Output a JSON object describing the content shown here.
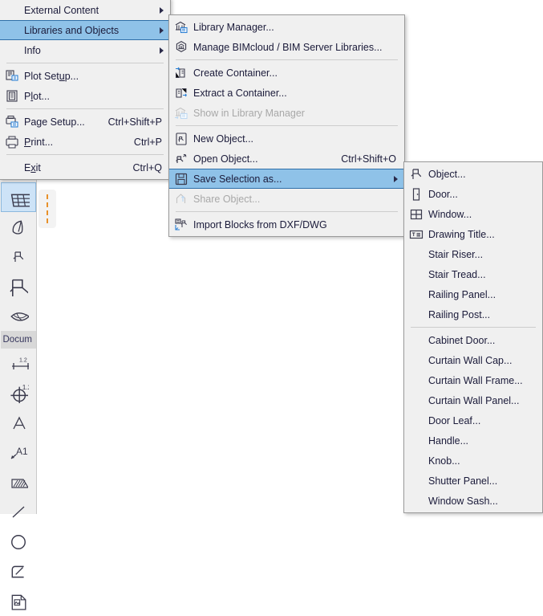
{
  "app": {
    "accent_highlight": "#8fc2e8",
    "highlight_border": "#2f6fa8",
    "panel_bg": "#f0f0f0",
    "panel_border": "#9a9a9a",
    "text_color": "#1b1b3a",
    "disabled_color": "#a8a8a8",
    "toolbar_bg": "#efefef",
    "toolbar_selected_bg": "#cde3f7",
    "canvas_bg": "#ffffff",
    "palette_dash_color": "#e8912a"
  },
  "toolbar": {
    "name": "toolbox-palette",
    "section_label": "Docum",
    "items": [
      {
        "name": "tool-shell",
        "icon": "shell-roof-icon",
        "selected": false
      },
      {
        "name": "tool-mesh",
        "icon": "mesh-grid-icon",
        "selected": true
      },
      {
        "name": "tool-morph",
        "icon": "morph-icon",
        "selected": false
      },
      {
        "name": "tool-object",
        "icon": "object-chair-icon",
        "selected": false
      },
      {
        "name": "tool-door",
        "icon": "door-panel-icon",
        "selected": false
      },
      {
        "name": "tool-roof-surface",
        "icon": "curved-surface-icon",
        "selected": false
      }
    ],
    "doc_items": [
      {
        "name": "tool-dimension",
        "icon": "linear-dimension-icon",
        "selected": false
      },
      {
        "name": "tool-radial-dimension",
        "icon": "radial-dimension-icon",
        "selected": false
      },
      {
        "name": "tool-text",
        "icon": "text-a-icon",
        "selected": false
      },
      {
        "name": "tool-label",
        "icon": "label-a1-icon",
        "selected": false
      },
      {
        "name": "tool-fill",
        "icon": "hatch-fill-icon",
        "selected": false
      },
      {
        "name": "tool-line",
        "icon": "line-icon",
        "selected": false
      },
      {
        "name": "tool-circle",
        "icon": "circle-icon",
        "selected": false
      },
      {
        "name": "tool-polyline",
        "icon": "polyline-icon",
        "selected": false
      },
      {
        "name": "tool-figure",
        "icon": "figure-image-icon",
        "selected": false
      }
    ]
  },
  "menu1": {
    "name": "file-menu",
    "items": [
      {
        "name": "menu-item-external-content",
        "label": "External Content",
        "shortcut": "",
        "icon": "",
        "submenu": true,
        "highlight": false,
        "disabled": false
      },
      {
        "name": "menu-item-libraries-objects",
        "label": "Libraries and Objects",
        "shortcut": "",
        "icon": "",
        "submenu": true,
        "highlight": true,
        "disabled": false
      },
      {
        "name": "menu-item-info",
        "label": "Info",
        "shortcut": "",
        "icon": "",
        "submenu": true,
        "highlight": false,
        "disabled": false
      },
      {
        "separator": true
      },
      {
        "name": "menu-item-plot-setup",
        "label": "Plot Setup...",
        "shortcut": "",
        "icon": "plot-setup-icon",
        "submenu": false,
        "highlight": false,
        "disabled": false,
        "mnemonic": "u"
      },
      {
        "name": "menu-item-plot",
        "label": "Plot...",
        "shortcut": "",
        "icon": "plotter-icon",
        "submenu": false,
        "highlight": false,
        "disabled": false,
        "mnemonic": "l"
      },
      {
        "separator": true
      },
      {
        "name": "menu-item-page-setup",
        "label": "Page Setup...",
        "shortcut": "Ctrl+Shift+P",
        "icon": "page-setup-icon",
        "submenu": false,
        "highlight": false,
        "disabled": false,
        "mnemonic": "g"
      },
      {
        "name": "menu-item-print",
        "label": "Print...",
        "shortcut": "Ctrl+P",
        "icon": "printer-icon",
        "submenu": false,
        "highlight": false,
        "disabled": false,
        "mnemonic": "P"
      },
      {
        "separator": true
      },
      {
        "name": "menu-item-exit",
        "label": "Exit",
        "shortcut": "Ctrl+Q",
        "icon": "",
        "submenu": false,
        "highlight": false,
        "disabled": false,
        "mnemonic": "x"
      }
    ]
  },
  "menu2": {
    "name": "libraries-and-objects-submenu",
    "items": [
      {
        "name": "menu-item-library-manager",
        "label": "Library Manager...",
        "shortcut": "",
        "icon": "library-manager-icon",
        "submenu": false,
        "highlight": false,
        "disabled": false
      },
      {
        "name": "menu-item-manage-bimcloud",
        "label": "Manage BIMcloud / BIM Server Libraries...",
        "shortcut": "",
        "icon": "bimcloud-icon",
        "submenu": false,
        "highlight": false,
        "disabled": false
      },
      {
        "separator": true
      },
      {
        "name": "menu-item-create-container",
        "label": "Create Container...",
        "shortcut": "",
        "icon": "create-container-icon",
        "submenu": false,
        "highlight": false,
        "disabled": false
      },
      {
        "name": "menu-item-extract-container",
        "label": "Extract a Container...",
        "shortcut": "",
        "icon": "extract-container-icon",
        "submenu": false,
        "highlight": false,
        "disabled": false
      },
      {
        "name": "menu-item-show-in-library-manager",
        "label": "Show in Library Manager",
        "shortcut": "",
        "icon": "show-in-library-icon",
        "submenu": false,
        "highlight": false,
        "disabled": true
      },
      {
        "separator": true
      },
      {
        "name": "menu-item-new-object",
        "label": "New Object...",
        "shortcut": "",
        "icon": "new-object-icon",
        "submenu": false,
        "highlight": false,
        "disabled": false
      },
      {
        "name": "menu-item-open-object",
        "label": "Open Object...",
        "shortcut": "Ctrl+Shift+O",
        "icon": "open-object-icon",
        "submenu": false,
        "highlight": false,
        "disabled": false
      },
      {
        "name": "menu-item-save-selection-as",
        "label": "Save Selection as...",
        "shortcut": "",
        "icon": "save-floppy-icon",
        "submenu": true,
        "highlight": true,
        "disabled": false
      },
      {
        "name": "menu-item-share-object",
        "label": "Share Object...",
        "shortcut": "",
        "icon": "share-object-icon",
        "submenu": false,
        "highlight": false,
        "disabled": true
      },
      {
        "separator": true
      },
      {
        "name": "menu-item-import-blocks",
        "label": "Import Blocks from DXF/DWG",
        "shortcut": "",
        "icon": "import-blocks-icon",
        "submenu": false,
        "highlight": false,
        "disabled": false
      }
    ]
  },
  "menu3": {
    "name": "save-selection-as-submenu",
    "items": [
      {
        "name": "menu-item-object",
        "label": "Object...",
        "icon": "object-chair-icon",
        "disabled": false
      },
      {
        "name": "menu-item-door",
        "label": "Door...",
        "icon": "door-icon",
        "disabled": false
      },
      {
        "name": "menu-item-window",
        "label": "Window...",
        "icon": "window-icon",
        "disabled": false
      },
      {
        "name": "menu-item-drawing-title",
        "label": "Drawing Title...",
        "icon": "drawing-title-icon",
        "disabled": false
      },
      {
        "name": "menu-item-stair-riser",
        "label": "Stair Riser...",
        "icon": "",
        "disabled": false
      },
      {
        "name": "menu-item-stair-tread",
        "label": "Stair Tread...",
        "icon": "",
        "disabled": false
      },
      {
        "name": "menu-item-railing-panel",
        "label": "Railing Panel...",
        "icon": "",
        "disabled": false
      },
      {
        "name": "menu-item-railing-post",
        "label": "Railing Post...",
        "icon": "",
        "disabled": false
      },
      {
        "separator": true
      },
      {
        "name": "menu-item-cabinet-door",
        "label": "Cabinet Door...",
        "icon": "",
        "disabled": false
      },
      {
        "name": "menu-item-curtain-wall-cap",
        "label": "Curtain Wall Cap...",
        "icon": "",
        "disabled": false
      },
      {
        "name": "menu-item-curtain-wall-frame",
        "label": "Curtain Wall Frame...",
        "icon": "",
        "disabled": false
      },
      {
        "name": "menu-item-curtain-wall-panel",
        "label": "Curtain Wall Panel...",
        "icon": "",
        "disabled": false
      },
      {
        "name": "menu-item-door-leaf",
        "label": "Door Leaf...",
        "icon": "",
        "disabled": false
      },
      {
        "name": "menu-item-handle",
        "label": "Handle...",
        "icon": "",
        "disabled": false
      },
      {
        "name": "menu-item-knob",
        "label": "Knob...",
        "icon": "",
        "disabled": false
      },
      {
        "name": "menu-item-shutter-panel",
        "label": "Shutter Panel...",
        "icon": "",
        "disabled": false
      },
      {
        "name": "menu-item-window-sash",
        "label": "Window Sash...",
        "icon": "",
        "disabled": false
      }
    ]
  }
}
